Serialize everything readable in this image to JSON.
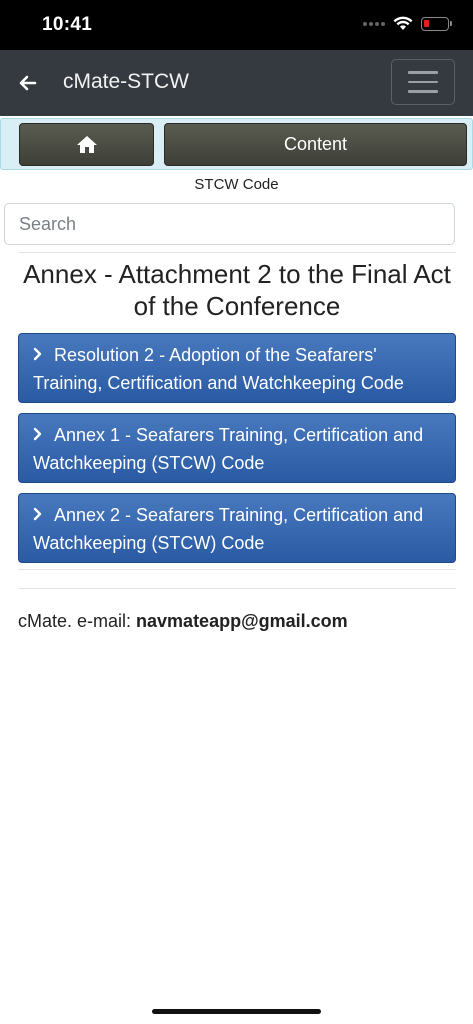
{
  "status_bar": {
    "time": "10:41"
  },
  "navbar": {
    "title": "cMate-STCW"
  },
  "toolbar": {
    "content_label": "Content"
  },
  "subtitle": "STCW Code",
  "search": {
    "placeholder": "Search"
  },
  "page_title": "Annex - Attachment 2 to the Final Act of the Conference",
  "items": [
    {
      "label": "Resolution 2 - Adoption of the Seafarers' Training, Certification and Watchkeeping Code"
    },
    {
      "label": "Annex 1 - Seafarers Training, Certification and Watchkeeping (STCW) Code"
    },
    {
      "label": "Annex 2 - Seafarers Training, Certification and Watchkeeping (STCW) Code"
    }
  ],
  "footer": {
    "prefix": "cMate. e-mail: ",
    "email": "navmateapp@gmail.com"
  },
  "colors": {
    "navbar": "#343a40",
    "toolbar_bg": "#d9eff5",
    "item_blue": "#2a5aa3",
    "battery_low": "#e0211d"
  }
}
